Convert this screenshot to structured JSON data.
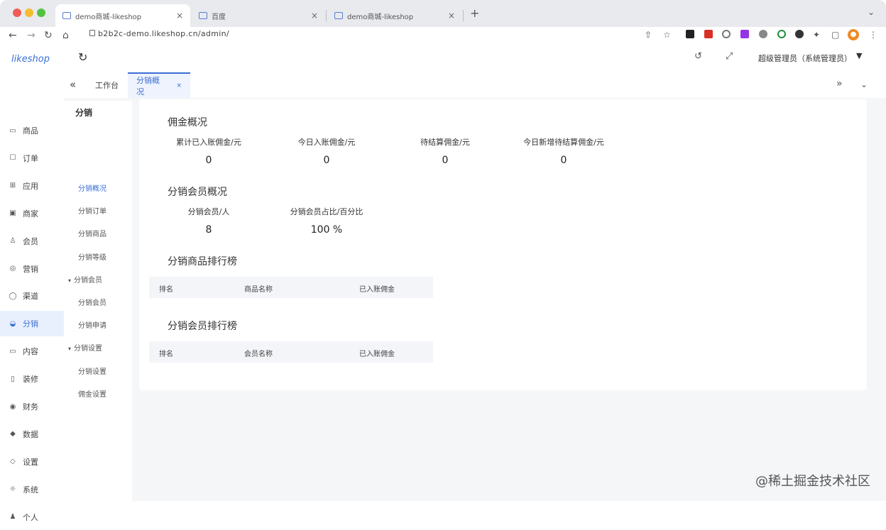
{
  "browser": {
    "tabs": [
      {
        "title": "demo商城-likeshop",
        "active": true
      },
      {
        "title": "百度",
        "active": false
      },
      {
        "title": "demo商城-likeshop",
        "active": false
      }
    ],
    "url": "b2b2c-demo.likeshop.cn/admin/"
  },
  "app": {
    "logo": "likeshop",
    "nav": [
      {
        "label": "商品",
        "icon": "goods-icon",
        "glyph": "▭"
      },
      {
        "label": "订单",
        "icon": "order-icon",
        "glyph": "☐"
      },
      {
        "label": "应用",
        "icon": "app-icon",
        "glyph": "⊞"
      },
      {
        "label": "商家",
        "icon": "shop-icon",
        "glyph": "▣"
      },
      {
        "label": "会员",
        "icon": "member-icon",
        "glyph": "♙"
      },
      {
        "label": "营销",
        "icon": "marketing-icon",
        "glyph": "◎"
      },
      {
        "label": "渠道",
        "icon": "channel-icon",
        "glyph": "◯"
      },
      {
        "label": "分销",
        "icon": "distribution-icon",
        "glyph": "◒",
        "active": true
      },
      {
        "label": "内容",
        "icon": "content-icon",
        "glyph": "▭"
      },
      {
        "label": "装修",
        "icon": "decorate-icon",
        "glyph": "▯"
      },
      {
        "label": "财务",
        "icon": "finance-icon",
        "glyph": "◉"
      },
      {
        "label": "数据",
        "icon": "data-icon",
        "glyph": "◆"
      },
      {
        "label": "设置",
        "icon": "settings-icon",
        "glyph": "◇"
      },
      {
        "label": "系统",
        "icon": "system-icon",
        "glyph": "☼"
      },
      {
        "label": "个人",
        "icon": "user-icon",
        "glyph": "♟"
      }
    ],
    "subnav": {
      "title": "分销",
      "items": [
        {
          "label": "分销概况",
          "active": true
        },
        {
          "label": "分销订单"
        },
        {
          "label": "分销商品"
        },
        {
          "label": "分销等级"
        },
        {
          "label": "分销会员",
          "group": true
        },
        {
          "label": "分销会员"
        },
        {
          "label": "分销申请"
        },
        {
          "label": "分销设置",
          "group": true
        },
        {
          "label": "分销设置"
        },
        {
          "label": "佣金设置"
        }
      ]
    },
    "header": {
      "admin": "超级管理员（系统管理员）"
    },
    "pagetabs": [
      {
        "label": "工作台"
      },
      {
        "label": "分销概况",
        "active": true,
        "close": "×"
      }
    ],
    "overview": {
      "commission_title": "佣金概况",
      "commission_stats": [
        {
          "label": "累计已入账佣金/元",
          "value": "0"
        },
        {
          "label": "今日入账佣金/元",
          "value": "0"
        },
        {
          "label": "待结算佣金/元",
          "value": "0"
        },
        {
          "label": "今日新增待结算佣金/元",
          "value": "0"
        }
      ],
      "member_title": "分销会员概况",
      "member_stats": [
        {
          "label": "分销会员/人",
          "value": "8"
        },
        {
          "label": "分销会员占比/百分比",
          "value": "100 %"
        }
      ],
      "goods_rank_title": "分销商品排行榜",
      "goods_rank_columns": [
        "排名",
        "商品名称",
        "已入账佣金"
      ],
      "member_rank_title": "分销会员排行榜",
      "member_rank_columns": [
        "排名",
        "会员名称",
        "已入账佣金"
      ]
    }
  },
  "watermark": "@稀土掘金技术社区"
}
